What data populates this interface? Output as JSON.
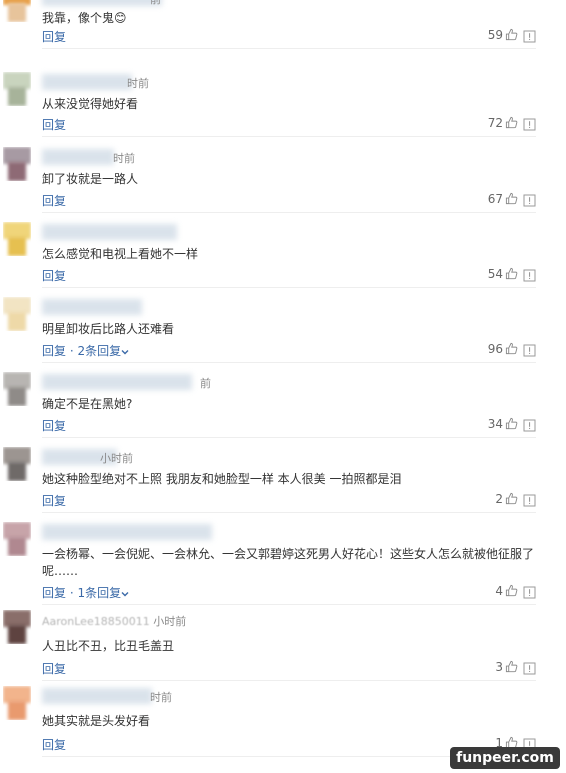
{
  "comments": [
    {
      "name": "",
      "time": "前",
      "text": "我靠，像个鬼😊",
      "reply": "回复",
      "replies": "",
      "likes": "59",
      "avatar": [
        "#e8a14a",
        "#e7c49b"
      ]
    },
    {
      "name": "",
      "time": "时前",
      "text": "从来没觉得她好看",
      "reply": "回复",
      "replies": "",
      "likes": "72",
      "avatar": [
        "#c9d4be",
        "#a7b39a"
      ]
    },
    {
      "name": "",
      "time": "时前",
      "text": "卸了妆就是一路人",
      "reply": "回复",
      "replies": "",
      "likes": "67",
      "avatar": [
        "#a79aa3",
        "#8e6a75"
      ]
    },
    {
      "name": "",
      "time": "",
      "text": "怎么感觉和电视上看她不一样",
      "reply": "回复",
      "replies": "",
      "likes": "54",
      "avatar": [
        "#f0d57a",
        "#e6c050"
      ]
    },
    {
      "name": "",
      "time": "",
      "text": "明星卸妆后比路人还难看",
      "reply": "回复",
      "replies": "· 2条回复",
      "likes": "96",
      "avatar": [
        "#f2e4c3",
        "#eed9a8"
      ]
    },
    {
      "name": "",
      "time": "前",
      "text": "确定不是在黑她?",
      "reply": "回复",
      "replies": "",
      "likes": "34",
      "avatar": [
        "#b8b5b2",
        "#8f8b88"
      ]
    },
    {
      "name": "",
      "time": "小时前",
      "text": "她这种脸型绝对不上照 我朋友和她脸型一样 本人很美 一拍照都是泪",
      "reply": "回复",
      "replies": "",
      "likes": "2",
      "avatar": [
        "#9c9591",
        "#6f6a68"
      ]
    },
    {
      "name": "",
      "time": "",
      "text": "一会杨幂、一会倪妮、一会林允、一会又郭碧婷这死男人好花心！这些女人怎么就被他征服了呢……",
      "reply": "回复",
      "replies": "· 1条回复",
      "likes": "4",
      "avatar": [
        "#c7a4a9",
        "#b08890"
      ]
    },
    {
      "name": "AaronLee18850011",
      "time": "小时前",
      "text": "人丑比不丑，比丑毛盖丑",
      "reply": "回复",
      "replies": "",
      "likes": "3",
      "avatar": [
        "#8a6e6a",
        "#5e4340"
      ]
    },
    {
      "name": "",
      "time": "时前",
      "text": "她其实就是头发好看",
      "reply": "回复",
      "replies": "",
      "likes": "1",
      "avatar": [
        "#f2b48c",
        "#e99a6e"
      ]
    }
  ],
  "colors": {
    "link": "#3b6aa8",
    "text": "#333333",
    "muted": "#888888"
  },
  "icons": {
    "like": "thumb-up-icon",
    "report": "report-icon",
    "expand": "chevron-down-icon"
  },
  "watermark": "funpeer.com"
}
